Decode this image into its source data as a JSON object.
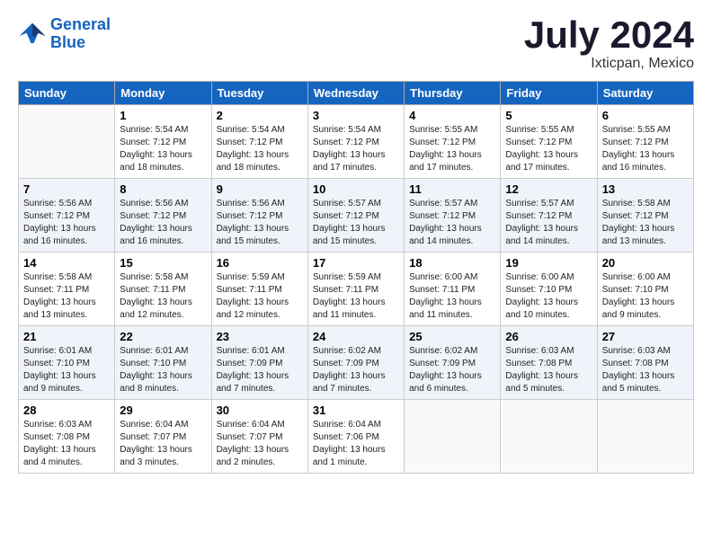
{
  "logo": {
    "line1": "General",
    "line2": "Blue"
  },
  "title": {
    "month_year": "July 2024",
    "location": "Ixticpan, Mexico"
  },
  "weekdays": [
    "Sunday",
    "Monday",
    "Tuesday",
    "Wednesday",
    "Thursday",
    "Friday",
    "Saturday"
  ],
  "weeks": [
    [
      {
        "num": "",
        "info": ""
      },
      {
        "num": "1",
        "info": "Sunrise: 5:54 AM\nSunset: 7:12 PM\nDaylight: 13 hours\nand 18 minutes."
      },
      {
        "num": "2",
        "info": "Sunrise: 5:54 AM\nSunset: 7:12 PM\nDaylight: 13 hours\nand 18 minutes."
      },
      {
        "num": "3",
        "info": "Sunrise: 5:54 AM\nSunset: 7:12 PM\nDaylight: 13 hours\nand 17 minutes."
      },
      {
        "num": "4",
        "info": "Sunrise: 5:55 AM\nSunset: 7:12 PM\nDaylight: 13 hours\nand 17 minutes."
      },
      {
        "num": "5",
        "info": "Sunrise: 5:55 AM\nSunset: 7:12 PM\nDaylight: 13 hours\nand 17 minutes."
      },
      {
        "num": "6",
        "info": "Sunrise: 5:55 AM\nSunset: 7:12 PM\nDaylight: 13 hours\nand 16 minutes."
      }
    ],
    [
      {
        "num": "7",
        "info": "Sunrise: 5:56 AM\nSunset: 7:12 PM\nDaylight: 13 hours\nand 16 minutes."
      },
      {
        "num": "8",
        "info": "Sunrise: 5:56 AM\nSunset: 7:12 PM\nDaylight: 13 hours\nand 16 minutes."
      },
      {
        "num": "9",
        "info": "Sunrise: 5:56 AM\nSunset: 7:12 PM\nDaylight: 13 hours\nand 15 minutes."
      },
      {
        "num": "10",
        "info": "Sunrise: 5:57 AM\nSunset: 7:12 PM\nDaylight: 13 hours\nand 15 minutes."
      },
      {
        "num": "11",
        "info": "Sunrise: 5:57 AM\nSunset: 7:12 PM\nDaylight: 13 hours\nand 14 minutes."
      },
      {
        "num": "12",
        "info": "Sunrise: 5:57 AM\nSunset: 7:12 PM\nDaylight: 13 hours\nand 14 minutes."
      },
      {
        "num": "13",
        "info": "Sunrise: 5:58 AM\nSunset: 7:12 PM\nDaylight: 13 hours\nand 13 minutes."
      }
    ],
    [
      {
        "num": "14",
        "info": "Sunrise: 5:58 AM\nSunset: 7:11 PM\nDaylight: 13 hours\nand 13 minutes."
      },
      {
        "num": "15",
        "info": "Sunrise: 5:58 AM\nSunset: 7:11 PM\nDaylight: 13 hours\nand 12 minutes."
      },
      {
        "num": "16",
        "info": "Sunrise: 5:59 AM\nSunset: 7:11 PM\nDaylight: 13 hours\nand 12 minutes."
      },
      {
        "num": "17",
        "info": "Sunrise: 5:59 AM\nSunset: 7:11 PM\nDaylight: 13 hours\nand 11 minutes."
      },
      {
        "num": "18",
        "info": "Sunrise: 6:00 AM\nSunset: 7:11 PM\nDaylight: 13 hours\nand 11 minutes."
      },
      {
        "num": "19",
        "info": "Sunrise: 6:00 AM\nSunset: 7:10 PM\nDaylight: 13 hours\nand 10 minutes."
      },
      {
        "num": "20",
        "info": "Sunrise: 6:00 AM\nSunset: 7:10 PM\nDaylight: 13 hours\nand 9 minutes."
      }
    ],
    [
      {
        "num": "21",
        "info": "Sunrise: 6:01 AM\nSunset: 7:10 PM\nDaylight: 13 hours\nand 9 minutes."
      },
      {
        "num": "22",
        "info": "Sunrise: 6:01 AM\nSunset: 7:10 PM\nDaylight: 13 hours\nand 8 minutes."
      },
      {
        "num": "23",
        "info": "Sunrise: 6:01 AM\nSunset: 7:09 PM\nDaylight: 13 hours\nand 7 minutes."
      },
      {
        "num": "24",
        "info": "Sunrise: 6:02 AM\nSunset: 7:09 PM\nDaylight: 13 hours\nand 7 minutes."
      },
      {
        "num": "25",
        "info": "Sunrise: 6:02 AM\nSunset: 7:09 PM\nDaylight: 13 hours\nand 6 minutes."
      },
      {
        "num": "26",
        "info": "Sunrise: 6:03 AM\nSunset: 7:08 PM\nDaylight: 13 hours\nand 5 minutes."
      },
      {
        "num": "27",
        "info": "Sunrise: 6:03 AM\nSunset: 7:08 PM\nDaylight: 13 hours\nand 5 minutes."
      }
    ],
    [
      {
        "num": "28",
        "info": "Sunrise: 6:03 AM\nSunset: 7:08 PM\nDaylight: 13 hours\nand 4 minutes."
      },
      {
        "num": "29",
        "info": "Sunrise: 6:04 AM\nSunset: 7:07 PM\nDaylight: 13 hours\nand 3 minutes."
      },
      {
        "num": "30",
        "info": "Sunrise: 6:04 AM\nSunset: 7:07 PM\nDaylight: 13 hours\nand 2 minutes."
      },
      {
        "num": "31",
        "info": "Sunrise: 6:04 AM\nSunset: 7:06 PM\nDaylight: 13 hours\nand 1 minute."
      },
      {
        "num": "",
        "info": ""
      },
      {
        "num": "",
        "info": ""
      },
      {
        "num": "",
        "info": ""
      }
    ]
  ]
}
